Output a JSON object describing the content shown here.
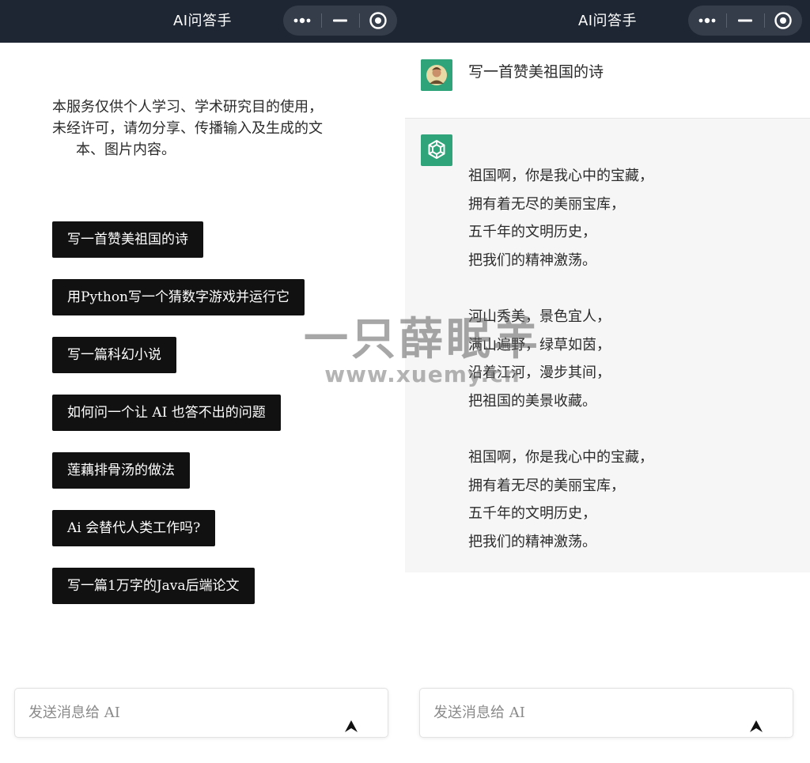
{
  "app_title": "AI问答手",
  "capsule": {
    "more_icon": "more-dots-icon",
    "minimize_icon": "minimize-icon",
    "close_icon": "target-circle-icon"
  },
  "colors": {
    "titlebar": "#1e2633",
    "capsule": "#353d4a",
    "prompt_button": "#111111",
    "ai_message_bg": "#f6f6f7",
    "avatar_bg": "#2fa37a"
  },
  "left_panel": {
    "notice_lines": [
      "本服务仅供个人学习、学术研究目的使用，",
      "未经许可，请勿分享、传播输入及生成的文",
      "本、图片内容。"
    ],
    "prompts": [
      "写一首赞美祖国的诗",
      "用Python写一个猜数字游戏并运行它",
      "写一篇科幻小说",
      "如何问一个让 AI 也答不出的问题",
      "莲藕排骨汤的做法",
      "Ai 会替代人类工作吗?",
      "写一篇1万字的Java后端论文"
    ],
    "input": {
      "placeholder": "发送消息给 AI",
      "value": ""
    }
  },
  "right_panel": {
    "user_message": "写一首赞美祖国的诗",
    "ai_message_lines": [
      "祖国啊，你是我心中的宝藏，",
      "拥有着无尽的美丽宝库，",
      "五千年的文明历史，",
      "把我们的精神激荡。",
      "",
      "河山秀美，景色宜人，",
      "满山遍野，绿草如茵，",
      "沿着江河，漫步其间，",
      "把祖国的美景收藏。",
      "",
      "祖国啊，你是我心中的宝藏，",
      "拥有着无尽的美丽宝库，",
      "五千年的文明历史，",
      "把我们的精神激荡。"
    ],
    "input": {
      "placeholder": "发送消息给 AI",
      "value": ""
    }
  },
  "watermark": {
    "brand": "一只薛眠羊",
    "url": "www.xuemy.cn"
  }
}
